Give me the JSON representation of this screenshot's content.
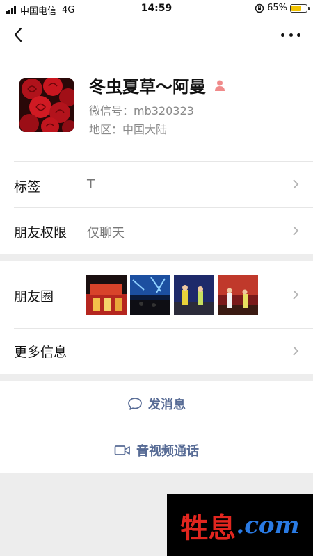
{
  "status_bar": {
    "carrier": "中国电信",
    "network": "4G",
    "time": "14:59",
    "battery_percent": "65%",
    "battery_level": 0.65,
    "icons": [
      "signal-icon",
      "orientation-lock-icon",
      "battery-icon"
    ]
  },
  "nav": {
    "back_icon": "chevron-left-icon",
    "more_icon": "more-dots-icon"
  },
  "profile": {
    "name": "冬虫夏草～阿曼",
    "wechat_id": "微信号：mb320323",
    "region": "地区：中国大陆",
    "gender_icon": "female-user-icon"
  },
  "rows": {
    "tags": {
      "label": "标签",
      "value": "T"
    },
    "permissions": {
      "label": "朋友权限",
      "value": "仅聊天"
    },
    "moments": {
      "label": "朋友圈"
    },
    "more_info": {
      "label": "更多信息"
    }
  },
  "actions": {
    "message": "发消息",
    "call": "音视频通话"
  },
  "watermark": {
    "text_a": "牲息",
    "text_b": ".com"
  },
  "colors": {
    "link": "#576b95",
    "background": "#ededed",
    "battery": "#f2c300"
  }
}
